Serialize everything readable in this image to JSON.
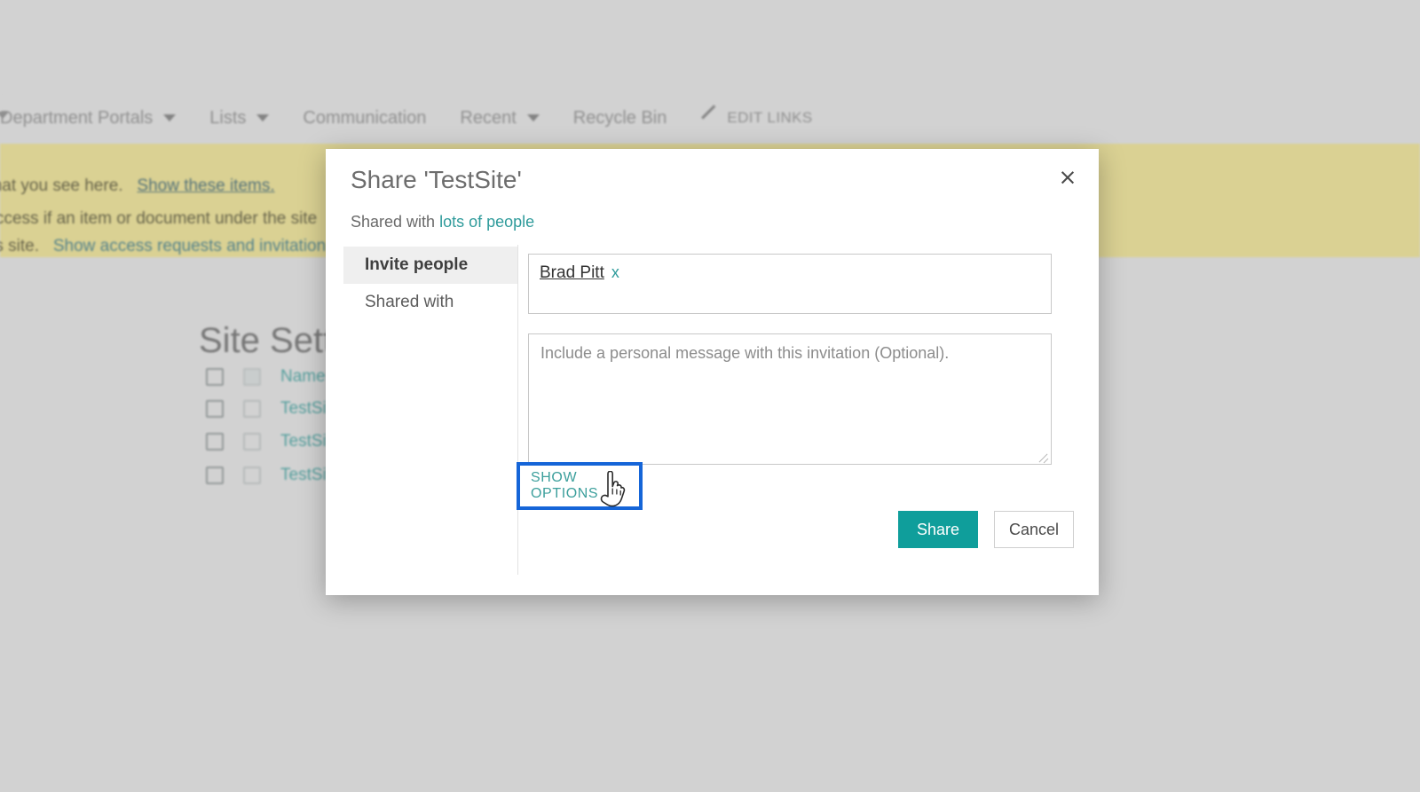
{
  "background": {
    "topnav": {
      "items": [
        {
          "label": "Department Portals",
          "has_caret": true
        },
        {
          "label": "Lists",
          "has_caret": true
        },
        {
          "label": "Communication",
          "has_caret": false
        },
        {
          "label": "Recent",
          "has_caret": true
        },
        {
          "label": "Recycle Bin",
          "has_caret": false
        }
      ],
      "edit_links_label": "EDIT LINKS"
    },
    "banner": {
      "line1_prefix": "what you see here.",
      "line1_link": "Show these items.",
      "line2": "ed access if an item or document under the site",
      "line3_prefix": "ss this site.",
      "line3_link": "Show access requests and invitation"
    },
    "page_title": "Site Sett",
    "list_rows": [
      {
        "label": "Name",
        "header": true
      },
      {
        "label": "TestSite",
        "header": false
      },
      {
        "label": "TestSite",
        "header": false
      },
      {
        "label": "TestSite",
        "header": false
      }
    ]
  },
  "dialog": {
    "title": "Share 'TestSite'",
    "close_label": "×",
    "shared_with_prefix": "Shared with",
    "shared_with_link": "lots of people",
    "tabs": [
      {
        "label": "Invite people",
        "active": true
      },
      {
        "label": "Shared with",
        "active": false
      }
    ],
    "people_picker": {
      "chip_name": "Brad Pitt",
      "chip_remove": "x"
    },
    "message": {
      "placeholder": "Include a personal message with this invitation (Optional)."
    },
    "show_options_label": "SHOW OPTIONS",
    "buttons": {
      "share": "Share",
      "cancel": "Cancel"
    }
  },
  "colors": {
    "accent_teal": "#0f9e9b",
    "link_teal": "#2f9b9b",
    "highlight_blue": "#1565d8",
    "banner_yellow": "#dbd18e",
    "page_gray": "#d2d2d2"
  }
}
